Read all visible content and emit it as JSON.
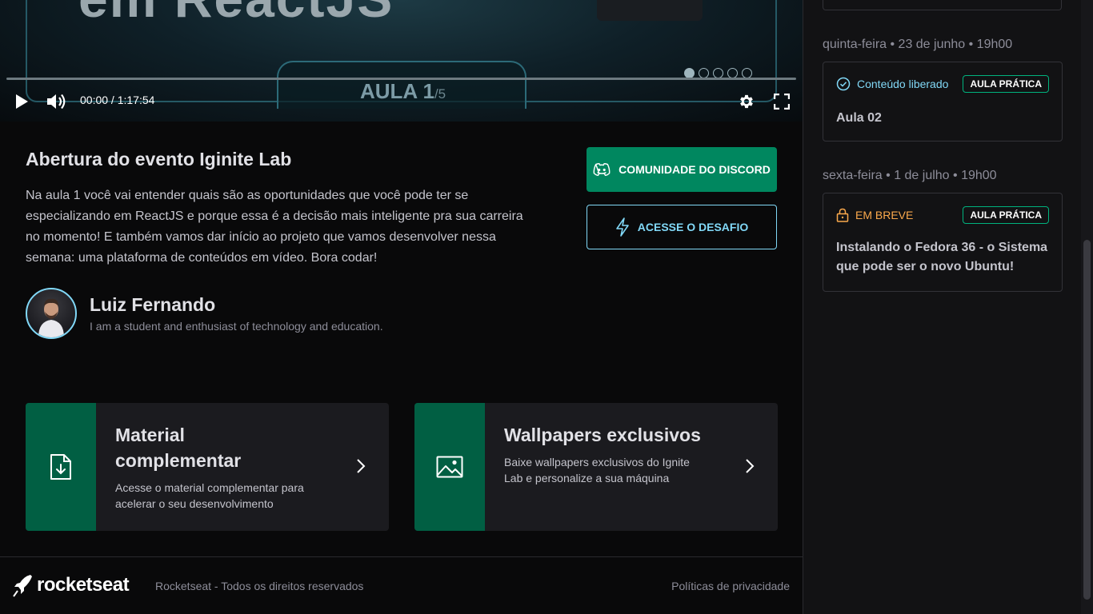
{
  "video": {
    "title_ghost": "em ReactJS",
    "lesson_label": "AULA 1",
    "lesson_total": "/5",
    "time": "00:00 / 1:17:54",
    "slide_dots": 5,
    "active_dot": 0,
    "progress": 0
  },
  "lesson": {
    "title": "Abertura do evento Iginite Lab",
    "description": "Na aula 1 você vai entender quais são as oportunidades que você pode ter se especializando em ReactJS e porque essa é a decisão mais inteligente pra sua carreira no momento! E também vamos dar início ao projeto que vamos desenvolver nessa semana: uma plataforma de conteúdos em vídeo. Bora codar!",
    "discord_button": "COMUNIDADE DO DISCORD",
    "challenge_button": "ACESSE O DESAFIO"
  },
  "author": {
    "name": "Luiz Fernando",
    "bio": "I am a student and enthusiast of technology and education."
  },
  "cards": [
    {
      "title": "Material complementar",
      "text": "Acesse o material complementar para acelerar o seu desenvolvimento",
      "icon": "file-download-icon"
    },
    {
      "title": "Wallpapers exclusivos",
      "text": "Baixe wallpapers exclusivos do Ignite Lab e personalize a sua máquina",
      "icon": "image-icon"
    }
  ],
  "footer": {
    "brand": "rocketseat",
    "copyright": "Rocketseat - Todos os direitos reservados",
    "privacy": "Políticas de privacidade"
  },
  "sidebar": {
    "lessons": [
      {
        "date": "quinta-feira • 23 de junho • 19h00",
        "status": "Conteúdo liberado",
        "status_icon": "check-circle-icon",
        "type": "AULA PRÁTICA",
        "title": "Aula 02"
      },
      {
        "date": "sexta-feira • 1 de julho • 19h00",
        "status": "EM BREVE",
        "status_icon": "lock-icon",
        "type": "AULA PRÁTICA",
        "title": "Instalando o Fedora 36 - o Sistema que pode ser o novo Ubuntu!"
      }
    ]
  },
  "colors": {
    "accent_green": "#00875f",
    "dark_green": "#015f43",
    "blue": "#81d8f7",
    "orange": "#fba94c",
    "badge_border": "#00b37e"
  }
}
